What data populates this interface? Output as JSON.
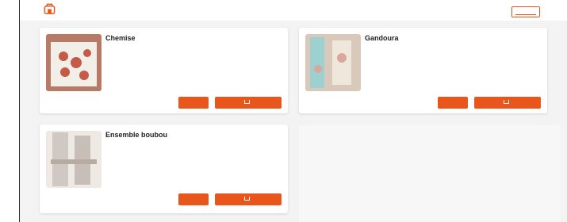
{
  "header": {
    "brand_text": "",
    "top_button_label": ""
  },
  "colors": {
    "accent": "#e9561b",
    "meta_text": "#8a6bb0"
  },
  "products": [
    {
      "title": "Chemise",
      "meta": "",
      "price": "",
      "buy_label": "",
      "cart_label": "",
      "thumb_colors": [
        "#d9a89a",
        "#f4f1ec",
        "#a85b45"
      ]
    },
    {
      "title": "Gandoura",
      "meta": "",
      "price": "",
      "buy_label": "",
      "cart_label": "",
      "thumb_colors": [
        "#cdb4a5",
        "#a6cfcf",
        "#ded6c8"
      ]
    },
    {
      "title": "Ensemble boubou",
      "meta": "",
      "price": "",
      "buy_label": "",
      "cart_label": "",
      "thumb_colors": [
        "#e6e1dc",
        "#c9c3be",
        "#b2a79f"
      ]
    }
  ]
}
